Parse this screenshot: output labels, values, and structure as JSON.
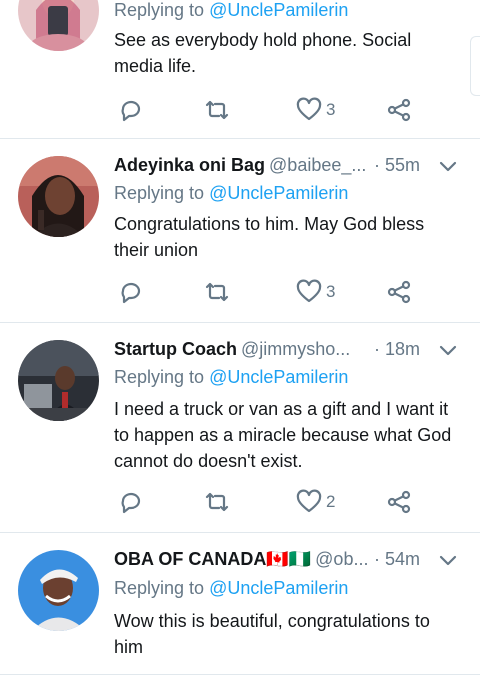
{
  "tweets": [
    {
      "replying_prefix": "Replying to",
      "mention": "@UnclePamilerin",
      "text": "See as everybody hold phone. Social media life.",
      "replies": "",
      "retweets": "",
      "likes": "3"
    },
    {
      "name": "Adeyinka oni Bag",
      "handle": "@baibee_...",
      "time": "· 55m",
      "replying_prefix": "Replying to",
      "mention": "@UnclePamilerin",
      "text": "Congratulations to him. May God bless their union",
      "likes": "3"
    },
    {
      "name": "Startup Coach",
      "handle": "@jimmysho...",
      "time": "· 18m",
      "replying_prefix": "Replying to",
      "mention": "@UnclePamilerin",
      "text": "I need a truck or van as a gift and I want it to happen as a miracle because what God cannot do doesn't exist.",
      "likes": "2"
    },
    {
      "name": "OBA OF CANADA🇨🇦🇳🇬",
      "handle": "@ob...",
      "time": "· 54m",
      "replying_prefix": "Replying to",
      "mention": "@UnclePamilerin",
      "text": "Wow this is beautiful, congratulations to him"
    }
  ],
  "icons": {
    "reply": "reply-icon",
    "retweet": "retweet-icon",
    "like": "heart-icon",
    "share": "share-icon",
    "menu": "chevron-down-icon"
  },
  "colors": {
    "mention": "#1da1f2",
    "muted": "#657786",
    "divider": "#e1e8ed"
  }
}
